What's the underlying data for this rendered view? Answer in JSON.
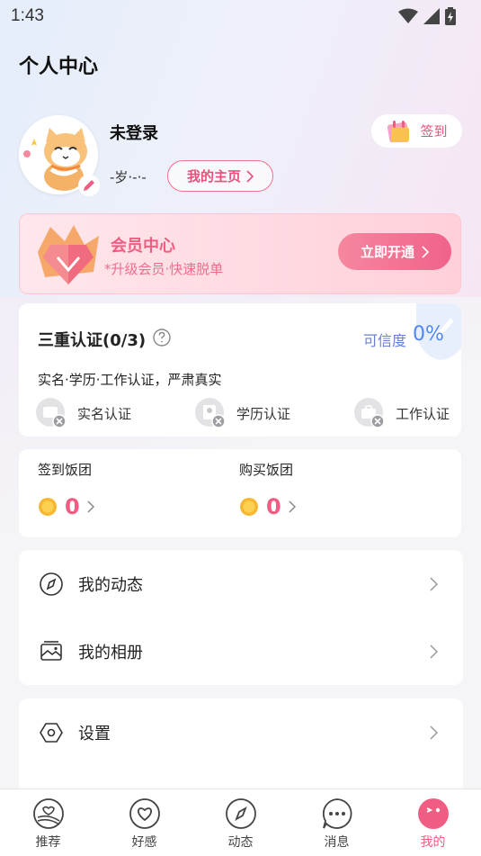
{
  "status_bar": {
    "time": "1:43"
  },
  "page_title": "个人中心",
  "profile": {
    "name": "未登录",
    "meta": "-岁·-·-",
    "homepage_label": "我的主页",
    "checkin_label": "签到"
  },
  "vip": {
    "title": "会员中心",
    "subtitle": "*升级会员·快速脱单",
    "button_label": "立即开通"
  },
  "verification": {
    "title": "三重认证(0/3)",
    "credibility_label": "可信度",
    "credibility_value": "0%",
    "description": "实名·学历·工作认证，严肃真实",
    "items": [
      {
        "label": "实名认证",
        "icon": "id-card-icon"
      },
      {
        "label": "学历认证",
        "icon": "education-icon"
      },
      {
        "label": "工作认证",
        "icon": "briefcase-icon"
      }
    ]
  },
  "coins": [
    {
      "label": "签到饭团",
      "value": "0"
    },
    {
      "label": "购买饭团",
      "value": "0"
    }
  ],
  "menu": [
    {
      "label": "我的动态",
      "icon": "compass-icon"
    },
    {
      "label": "我的相册",
      "icon": "album-icon"
    }
  ],
  "settings": {
    "label": "设置",
    "icon": "settings-hexagon-icon"
  },
  "tabs": [
    {
      "label": "推荐",
      "icon": "recommend-icon",
      "active": false
    },
    {
      "label": "好感",
      "icon": "heart-icon",
      "active": false
    },
    {
      "label": "动态",
      "icon": "compass-icon",
      "active": false
    },
    {
      "label": "消息",
      "icon": "message-icon",
      "active": false
    },
    {
      "label": "我的",
      "icon": "profile-face-icon",
      "active": true
    }
  ],
  "colors": {
    "accent": "#ef5e82",
    "blue": "#4f86f7"
  }
}
